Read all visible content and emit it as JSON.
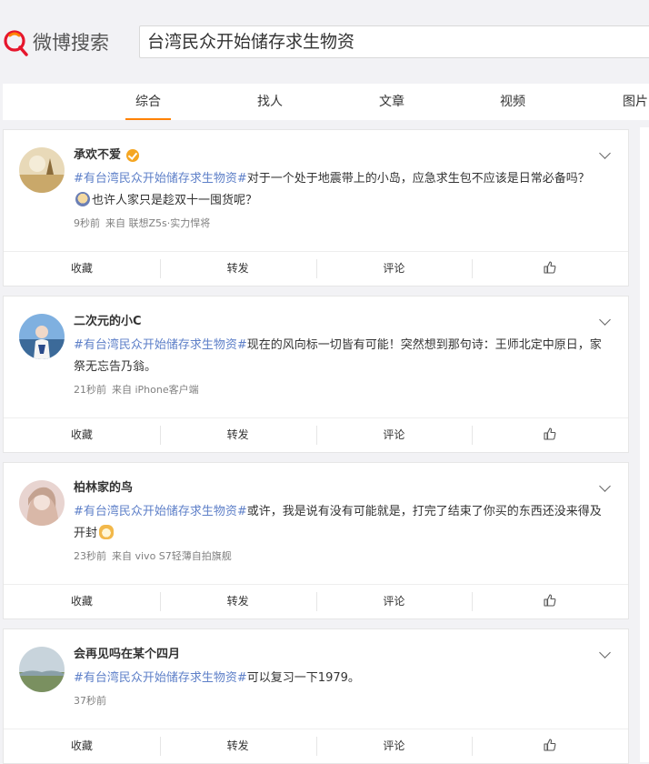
{
  "header": {
    "logo_text": "微博搜索",
    "search_value": "台湾民众开始储存求生物资"
  },
  "tabs": [
    {
      "label": "综合",
      "active": true
    },
    {
      "label": "找人"
    },
    {
      "label": "文章"
    },
    {
      "label": "视频"
    },
    {
      "label": "图片"
    }
  ],
  "colors": {
    "accent": "#ff8200",
    "topic_link": "#5d7fc8",
    "verified": "#f5a623"
  },
  "posts": [
    {
      "user": "承欢不爱",
      "verified": true,
      "topic": "#有台湾民众开始储存求生物资#",
      "text_a": "对于一个处于地震带上的小岛，应急求生包不应该是日常必备吗？",
      "emoji": "doge-emoji",
      "text_b": "也许人家只是趁双十一囤货呢？",
      "time": "9秒前",
      "source": "来自 联想Z5s·实力悍将",
      "actions": {
        "fav": "收藏",
        "repost": "转发",
        "comment": "评论"
      }
    },
    {
      "user": "二次元的小C",
      "verified": false,
      "topic": "#有台湾民众开始储存求生物资#",
      "text_a": "现在的风向标一切皆有可能！突然想到那句诗：王师北定中原日，家祭无忘告乃翁。",
      "time": "21秒前",
      "source": "来自 iPhone客户端",
      "actions": {
        "fav": "收藏",
        "repost": "转发",
        "comment": "评论"
      }
    },
    {
      "user": "柏林家的鸟",
      "verified": false,
      "topic": "#有台湾民众开始储存求生物资#",
      "text_a": "或许，我是说有没有可能就是，打完了结束了你买的东西还没来得及开封",
      "emoji": "cat-emoji",
      "time": "23秒前",
      "source": "来自 vivo S7轻薄自拍旗舰",
      "actions": {
        "fav": "收藏",
        "repost": "转发",
        "comment": "评论"
      }
    },
    {
      "user": "会再见吗在某个四月",
      "verified": false,
      "topic": "#有台湾民众开始储存求生物资#",
      "text_a": "可以复习一下1979。",
      "time": "37秒前",
      "source": "",
      "actions": {
        "fav": "收藏",
        "repost": "转发",
        "comment": "评论"
      }
    }
  ]
}
